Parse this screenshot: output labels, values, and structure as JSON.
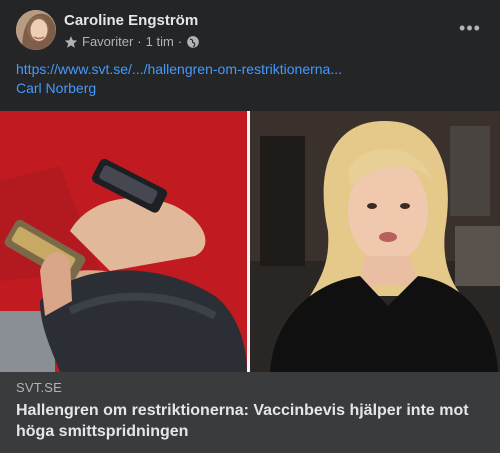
{
  "post": {
    "author": "Caroline Engström",
    "audience": "Favoriter",
    "separator": "·",
    "time": "1 tim",
    "separator2": "·",
    "link_text": "https://www.svt.se/.../hallengren-om-restriktionerna...",
    "tagged_name": "Carl Norberg"
  },
  "link_preview": {
    "domain": "SVT.SE",
    "title": "Hallengren om restriktionerna: Vaccinbevis hjälper inte mot höga smittspridningen"
  },
  "icons": {
    "favorites": "star-icon",
    "privacy": "globe-icon",
    "more": "more-options-icon"
  },
  "colors": {
    "card": "#242526",
    "link": "#4599ff",
    "preview_bg": "#3a3b3c"
  }
}
